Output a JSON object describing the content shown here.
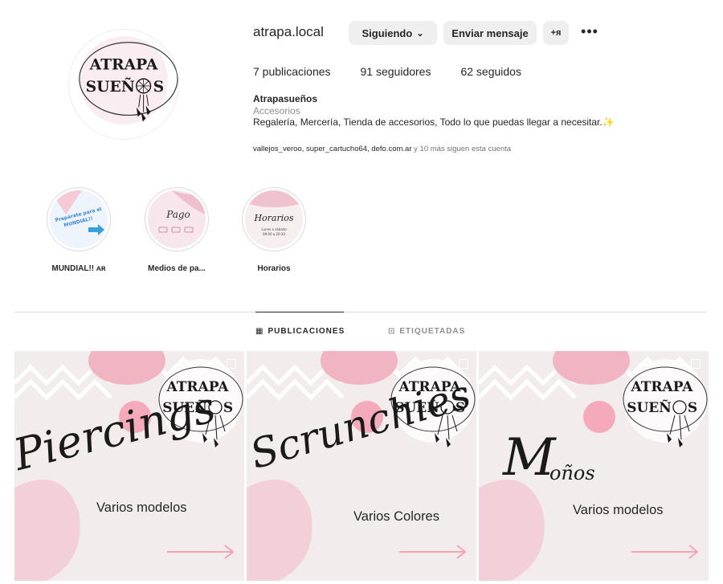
{
  "profile": {
    "username": "atrapa.local",
    "avatar_text_line1": "ATRAPA",
    "avatar_text_line2": "SUEÑ",
    "avatar_text_line3": "S",
    "follow_button": "Siguiendo",
    "message_button": "Enviar mensaje",
    "suggest_button": "+ᴙ",
    "more_icon": "•••",
    "stats": {
      "posts": "7 publicaciones",
      "followers": "91 seguidores",
      "following": "62 seguidos"
    },
    "bio": {
      "name": "Atrapasueños",
      "category": "Accesorios",
      "text": "Regalería, Mercería, Tienda de accesorios, Todo lo que puedas llegar a necesitar.✨"
    },
    "followed_by": {
      "names": "vallejos_veroo, super_cartucho64, defo.com.ar",
      "rest": " y 10 más siguen esta cuenta"
    }
  },
  "highlights": [
    {
      "label": "MUNDIAL!! ᴀʀ",
      "cover_text": "Prepárate para el MUNDIAL!!"
    },
    {
      "label": "Medios de pa...",
      "cover_text": "Pago"
    },
    {
      "label": "Horarios",
      "cover_text": "Horarios"
    }
  ],
  "tabs": {
    "posts": "PUBLICACIONES",
    "tagged": "ETIQUETADAS"
  },
  "posts": [
    {
      "script": "Piercings",
      "subtitle": "Varios modelos",
      "logo_line1": "ATRAPA",
      "logo_line2": "SUEÑ",
      "logo_line3": "S"
    },
    {
      "script": "Scrunchies",
      "subtitle": "Varios Colores",
      "logo_line1": "ATRAPA",
      "logo_line2": "SUEÑ",
      "logo_line3": "S"
    },
    {
      "script": "M",
      "script2": "oños",
      "subtitle": "Varios modelos",
      "logo_line1": "ATRAPA",
      "logo_line2": "SUEÑ",
      "logo_line3": "S"
    }
  ],
  "colors": {
    "button_bg": "#efefef",
    "post_bg": "#f3ecec",
    "accent_pink": "#f1a7b8",
    "muted_text": "#8e8e8e"
  }
}
